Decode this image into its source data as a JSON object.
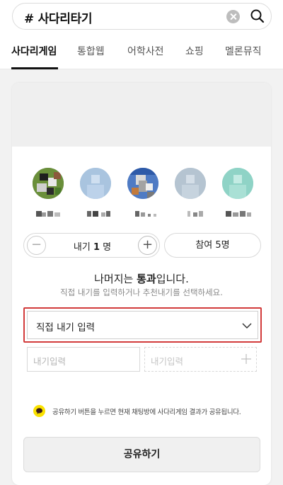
{
  "search": {
    "query": "# 사다리타기",
    "clear_icon": "clear-icon",
    "search_icon": "search-icon"
  },
  "tabs": [
    {
      "label": "사다리게임",
      "active": true
    },
    {
      "label": "통합웹",
      "active": false
    },
    {
      "label": "어학사전",
      "active": false
    },
    {
      "label": "쇼핑",
      "active": false
    },
    {
      "label": "멜론뮤직",
      "active": false
    }
  ],
  "game": {
    "participants_count": 5,
    "stepper": {
      "prefix": "내기",
      "value": "1",
      "unit": "명",
      "minus_icon": "minus-icon",
      "plus_icon": "plus-icon"
    },
    "join_label": "참여 5명",
    "rest_prefix": "나머지는 ",
    "rest_bold": "통과",
    "rest_suffix": "입니다.",
    "hint": "직접 내기를 입력하거나 추천내기를 선택하세요.",
    "select_value": "직접 내기 입력",
    "bet_placeholder": "내기입력",
    "bet_add_placeholder": "내기입력",
    "notice": "공유하기 버튼을 누르면 현재 채팅방에 사다리게임 결과가 공유됩니다.",
    "share_label": "공유하기"
  },
  "colors": {
    "accent_border": "#d23b3b",
    "notice_icon": "#fae100"
  }
}
